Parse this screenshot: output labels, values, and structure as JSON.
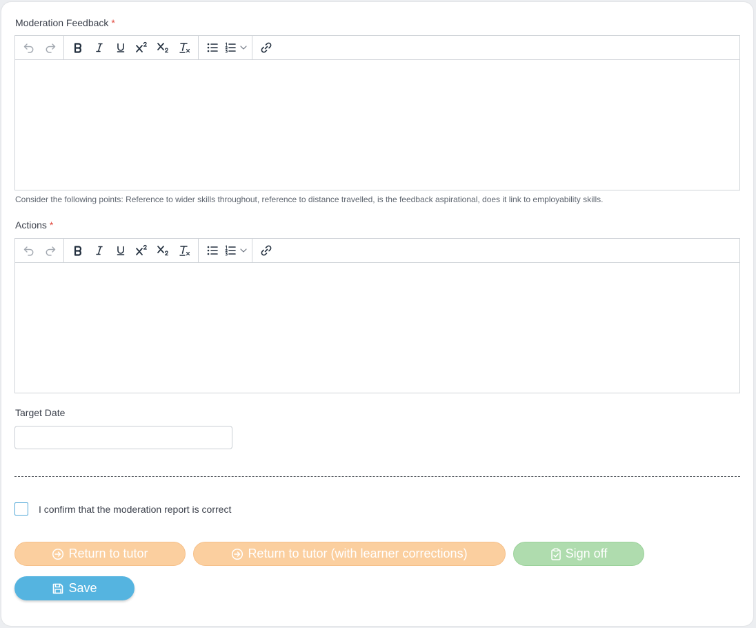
{
  "moderation_feedback": {
    "label": "Moderation Feedback",
    "required_mark": "*",
    "help_text": "Consider the following points: Reference to wider skills throughout, reference to distance travelled, is the feedback aspirational, does it link to employability skills.",
    "value": ""
  },
  "actions": {
    "label": "Actions",
    "required_mark": "*",
    "value": ""
  },
  "target_date": {
    "label": "Target Date",
    "value": ""
  },
  "confirm": {
    "label": "I confirm that the moderation report is correct",
    "checked": false
  },
  "buttons": {
    "return_to_tutor": "Return to tutor",
    "return_to_tutor_corrections": "Return to tutor (with learner corrections)",
    "sign_off": "Sign off",
    "save": "Save"
  },
  "colors": {
    "return_button": "#fbcf9f",
    "sign_off_button": "#afdcae",
    "save_button": "#55b4e0",
    "required": "#e0463b",
    "checkbox_border": "#4ea6d6"
  },
  "toolbar_icons": [
    "undo-icon",
    "redo-icon",
    "bold-icon",
    "italic-icon",
    "underline-icon",
    "superscript-icon",
    "subscript-icon",
    "clear-formatting-icon",
    "bullet-list-icon",
    "numbered-list-icon",
    "chevron-down-icon",
    "link-icon"
  ]
}
